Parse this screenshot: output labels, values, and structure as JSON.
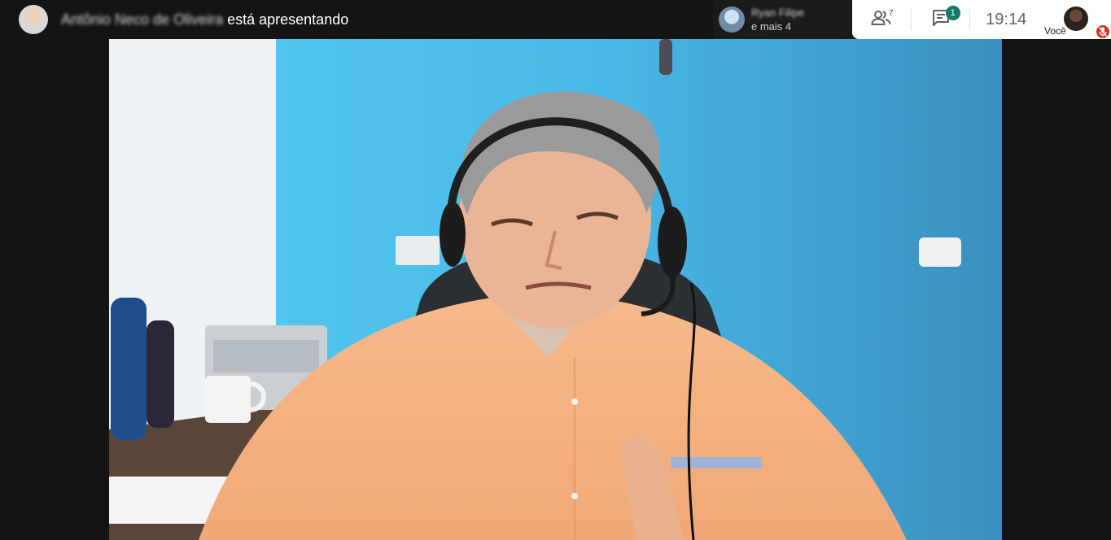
{
  "presenter": {
    "name": "Antônio Neco de Oliveira",
    "suffix": "está apresentando"
  },
  "participants_chip": {
    "name": "Ryan Filipe",
    "more": "e mais 4"
  },
  "toolbar": {
    "people_count": "7",
    "chat_badge": "1",
    "clock": "19:14"
  },
  "self_view": {
    "label": "Você"
  },
  "icons": {
    "people": "people-icon",
    "chat": "chat-icon",
    "mic_off": "mic-off-icon"
  },
  "colors": {
    "background": "#141414",
    "toolbar": "#ffffff",
    "badge": "#137a6a",
    "mic_off": "#d93025",
    "wall_blue": "#4fc2ec"
  }
}
